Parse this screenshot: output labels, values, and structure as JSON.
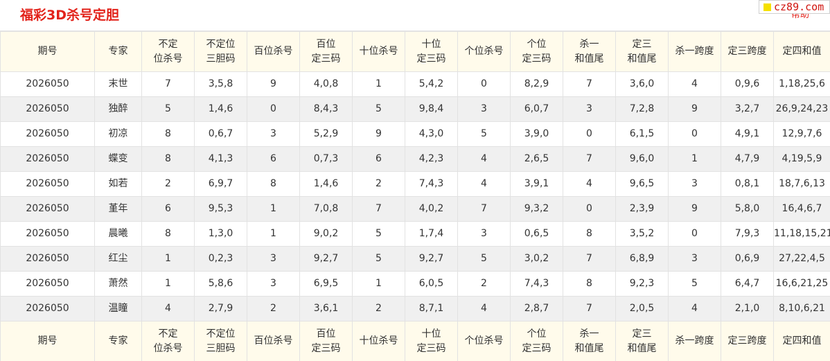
{
  "page": {
    "title": "福彩3D杀号定胆",
    "help_label": "帮助",
    "watermark": "cz89.com"
  },
  "table": {
    "columns": [
      [
        "期号"
      ],
      [
        "专家"
      ],
      [
        "不定",
        "位杀号"
      ],
      [
        "不定位",
        "三胆码"
      ],
      [
        "百位杀号"
      ],
      [
        "百位",
        "定三码"
      ],
      [
        "十位杀号"
      ],
      [
        "十位",
        "定三码"
      ],
      [
        "个位杀号"
      ],
      [
        "个位",
        "定三码"
      ],
      [
        "杀一",
        "和值尾"
      ],
      [
        "定三",
        "和值尾"
      ],
      [
        "杀一跨度"
      ],
      [
        "定三跨度"
      ],
      [
        "定四和值"
      ]
    ],
    "rows": [
      [
        "2026050",
        "末世",
        "7",
        "3,5,8",
        "9",
        "4,0,8",
        "1",
        "5,4,2",
        "0",
        "8,2,9",
        "7",
        "3,6,0",
        "4",
        "0,9,6",
        "1,18,25,6"
      ],
      [
        "2026050",
        "独醉",
        "5",
        "1,4,6",
        "0",
        "8,4,3",
        "5",
        "9,8,4",
        "3",
        "6,0,7",
        "3",
        "7,2,8",
        "9",
        "3,2,7",
        "26,9,24,23"
      ],
      [
        "2026050",
        "初凉",
        "8",
        "0,6,7",
        "3",
        "5,2,9",
        "9",
        "4,3,0",
        "5",
        "3,9,0",
        "0",
        "6,1,5",
        "0",
        "4,9,1",
        "12,9,7,6"
      ],
      [
        "2026050",
        "蝶变",
        "8",
        "4,1,3",
        "6",
        "0,7,3",
        "6",
        "4,2,3",
        "4",
        "2,6,5",
        "7",
        "9,6,0",
        "1",
        "4,7,9",
        "4,19,5,9"
      ],
      [
        "2026050",
        "如若",
        "2",
        "6,9,7",
        "8",
        "1,4,6",
        "2",
        "7,4,3",
        "4",
        "3,9,1",
        "4",
        "9,6,5",
        "3",
        "0,8,1",
        "18,7,6,13"
      ],
      [
        "2026050",
        "堇年",
        "6",
        "9,5,3",
        "1",
        "7,0,8",
        "7",
        "4,0,2",
        "7",
        "9,3,2",
        "0",
        "2,3,9",
        "9",
        "5,8,0",
        "16,4,6,7"
      ],
      [
        "2026050",
        "晨曦",
        "8",
        "1,3,0",
        "1",
        "9,0,2",
        "5",
        "1,7,4",
        "3",
        "0,6,5",
        "8",
        "3,5,2",
        "0",
        "7,9,3",
        "11,18,15,21"
      ],
      [
        "2026050",
        "红尘",
        "1",
        "0,2,3",
        "3",
        "9,2,7",
        "5",
        "9,2,7",
        "5",
        "3,0,2",
        "7",
        "6,8,9",
        "3",
        "0,6,9",
        "27,22,4,5"
      ],
      [
        "2026050",
        "萧然",
        "1",
        "5,8,6",
        "3",
        "6,9,5",
        "1",
        "6,0,5",
        "2",
        "7,4,3",
        "8",
        "9,2,3",
        "5",
        "6,4,7",
        "16,6,21,25"
      ],
      [
        "2026050",
        "温瞳",
        "4",
        "2,7,9",
        "2",
        "3,6,1",
        "2",
        "8,7,1",
        "4",
        "2,8,7",
        "7",
        "2,0,5",
        "4",
        "2,1,0",
        "8,10,6,21"
      ]
    ]
  },
  "colors": {
    "title": "#e2221a",
    "header_bg": "#fffbeb",
    "row_alt_bg": "#f0f0f0",
    "border": "#e2e2e2"
  }
}
